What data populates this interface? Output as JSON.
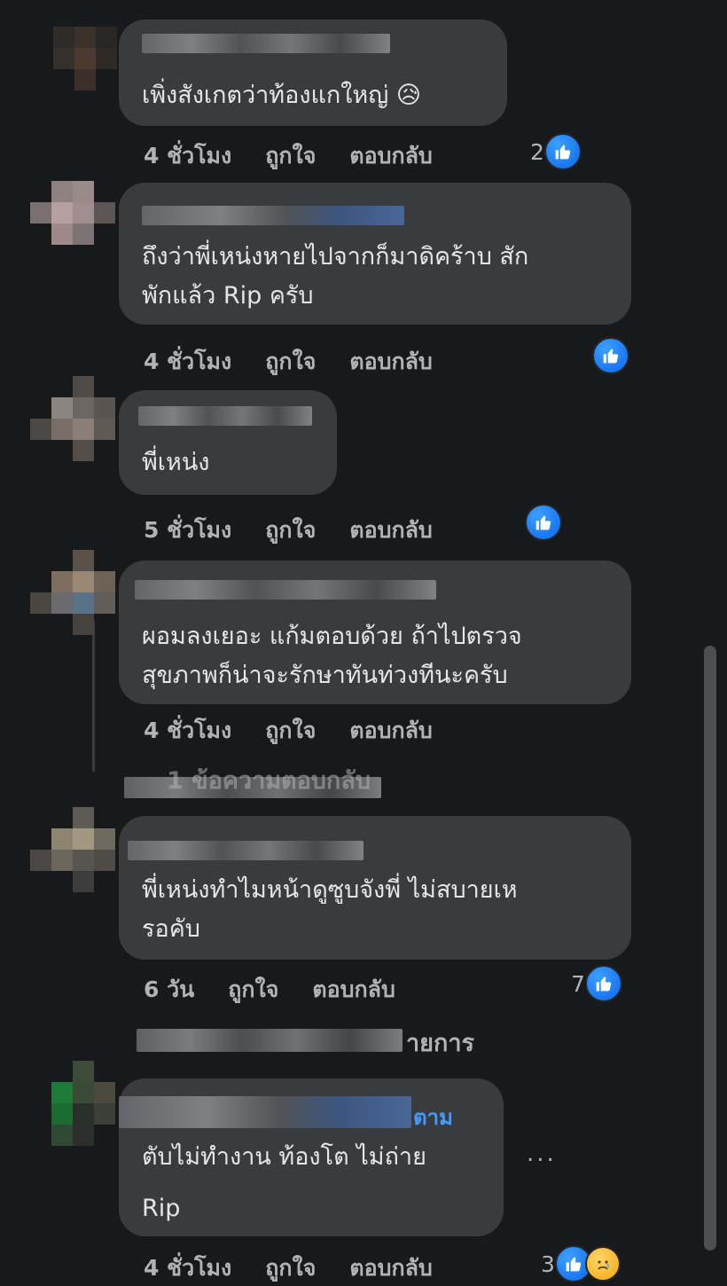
{
  "comments": [
    {
      "text": "เพิ่งสังเกตว่าท้องแกใหญ่ 😥",
      "time": "4 ชั่วโมง",
      "like": "ถูกใจ",
      "reply": "ตอบกลับ",
      "count": "2"
    },
    {
      "text": "ถึงว่าพี่เหน่งหายไปจากก็มาดิคร้าบ สัก\nพักแล้ว Rip ครับ",
      "time": "4 ชั่วโมง",
      "like": "ถูกใจ",
      "reply": "ตอบกลับ",
      "count": ""
    },
    {
      "text": "พี่เหน่ง",
      "time": "5 ชั่วโมง",
      "like": "ถูกใจ",
      "reply": "ตอบกลับ",
      "count": ""
    },
    {
      "text": "ผอมลงเยอะ แก้มตอบด้วย ถ้าไปตรวจ\nสุขภาพก็น่าจะรักษาทันท่วงทีนะครับ",
      "time": "4 ชั่วโมง",
      "like": "ถูกใจ",
      "reply": "ตอบกลับ",
      "count": ""
    },
    {
      "text": "พี่เหน่งทำไมหน้าดูซูบจังพี่ ไม่สบายเห\nรอคับ",
      "time": "6 วัน",
      "like": "ถูกใจ",
      "reply": "ตอบกลับ",
      "count": "7"
    },
    {
      "text": "ตับไม่ทำงาน ท้องโต ไม่ถ่าย\nRip",
      "time": "4 ชั่วโมง",
      "like": "ถูกใจ",
      "reply": "ตอบกลับ",
      "count": "3",
      "name_suffix": "ตาม"
    }
  ],
  "more_replies_1": "1 ข้อความตอบกลับ",
  "more_replies_2": "ายการ",
  "more_dots": "...",
  "colors": {
    "bg": "#18191a",
    "bubble": "#3a3b3c",
    "accent": "#1877f2"
  }
}
